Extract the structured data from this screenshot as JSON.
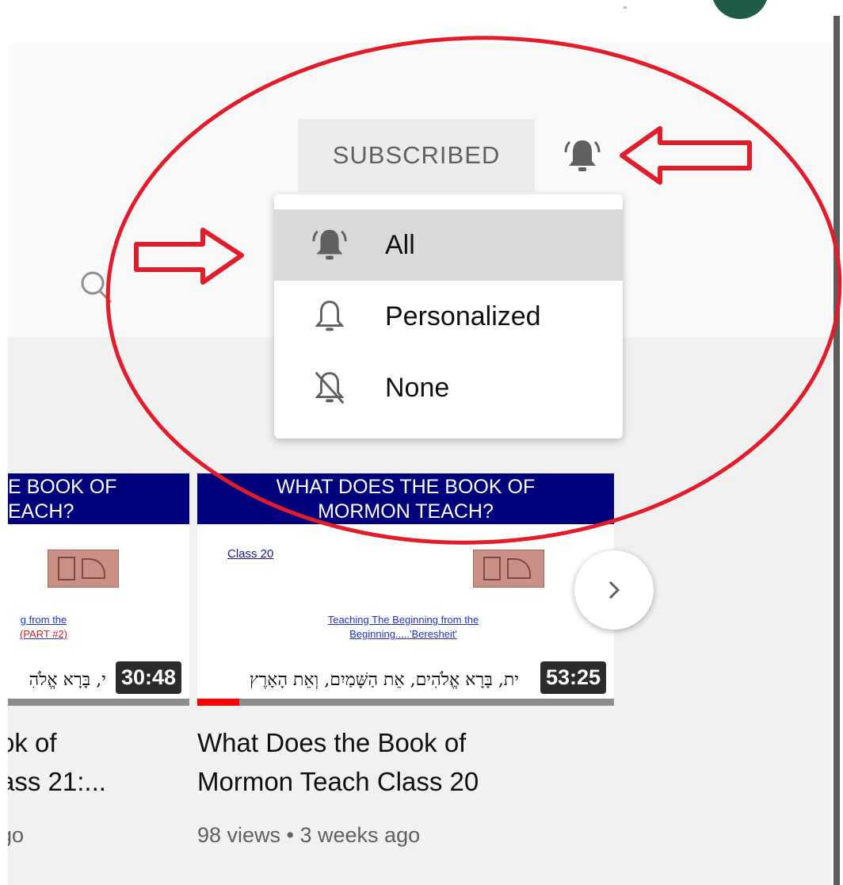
{
  "header": {
    "subscribed_label": "SUBSCRIBED",
    "bell_icon": "bell-ringing-icon"
  },
  "notification_menu": {
    "items": [
      {
        "label": "All",
        "icon": "bell-ringing-icon",
        "selected": true
      },
      {
        "label": "Personalized",
        "icon": "bell-outline-icon",
        "selected": false
      },
      {
        "label": "None",
        "icon": "bell-off-icon",
        "selected": false
      }
    ]
  },
  "videos": [
    {
      "banner_line1": "E BOOK OF",
      "banner_line2": "EACH?",
      "teach_line1": "g from the",
      "teach_line2": "(PART #2)",
      "hebrew": "י, בָּרָא אֱלֹהִ",
      "duration": "30:48",
      "title_line1": "ok of",
      "title_line2": "ass 21:...",
      "meta": "go",
      "watched_fraction": 0
    },
    {
      "banner_line1": "WHAT DOES THE BOOK OF",
      "banner_line2": "MORMON TEACH?",
      "class_label": "Class 20",
      "teach_line1": "Teaching The Beginning from the",
      "teach_line2": "Beginning.....'Beresheit'",
      "hebrew": "ית, בָּרָא אֱלֹהִים, אֵת הַשָּׁמַיִם, וְאֵת הָאָרֶץ",
      "duration": "53:25",
      "title_line1": "What Does the Book of",
      "title_line2": "Mormon Teach Class 20",
      "meta": "98 views • 3 weeks ago",
      "watched_fraction": 0.1
    }
  ],
  "annotation_color": "#e21c2a"
}
